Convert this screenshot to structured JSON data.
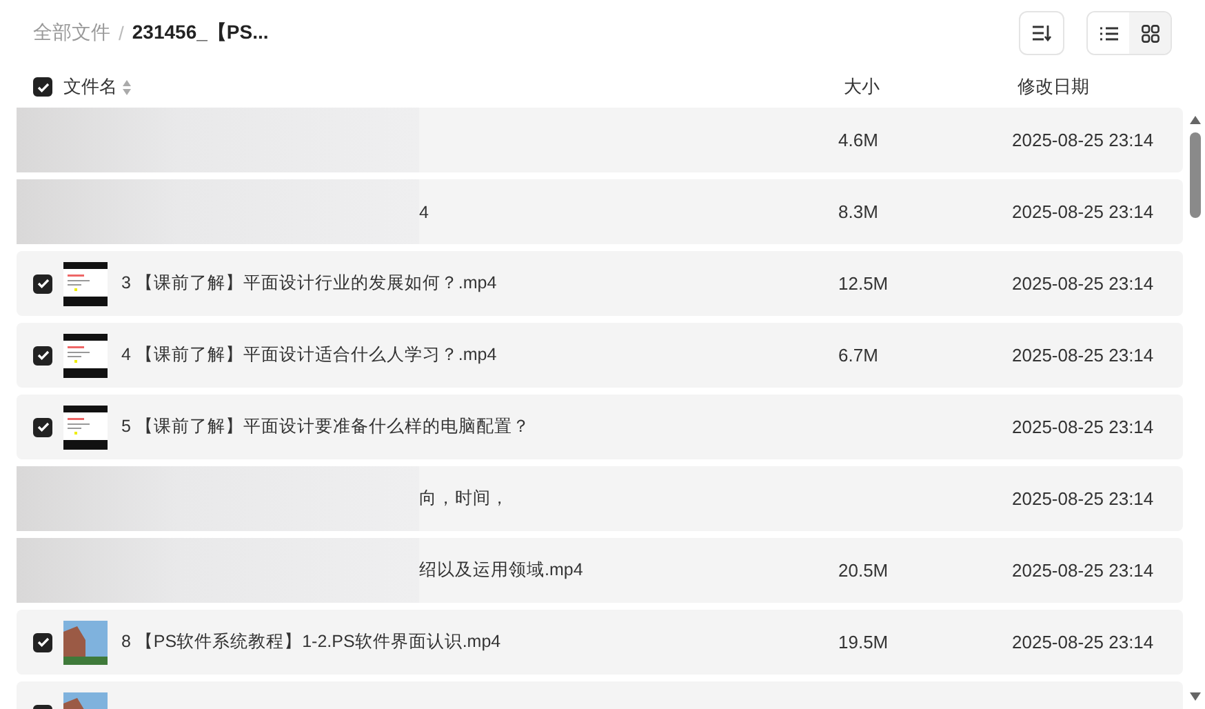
{
  "breadcrumb": [
    {
      "label": "全部文件",
      "current": false
    },
    {
      "label": "231456_【PS...",
      "current": true
    }
  ],
  "separator": "/",
  "view_toggle": [
    {
      "kind": "list",
      "selected": true
    },
    {
      "kind": "grid",
      "selected": false
    }
  ],
  "table": {
    "all_checked": true,
    "columns": [
      "文件名",
      "大小",
      "修改日期"
    ],
    "rows": [
      {
        "kind": "blurred",
        "size": "4.6M",
        "date": "2025-08-25 23:14"
      },
      {
        "kind": "blurred",
        "name": "4",
        "size": "8.3M",
        "date": "2025-08-25 23:14"
      },
      {
        "kind": "slide",
        "checked": true,
        "name": "3 【课前了解】平面设计行业的发展如何？.mp4",
        "size": "12.5M",
        "date": "2025-08-25 23:14"
      },
      {
        "kind": "slide",
        "checked": true,
        "name": "4 【课前了解】平面设计适合什么人学习？.mp4",
        "size": "6.7M",
        "date": "2025-08-25 23:14"
      },
      {
        "kind": "slide",
        "checked": true,
        "name": "5 【课前了解】平面设计要准备什么样的电脑配置？",
        "date": "2025-08-25 23:14"
      },
      {
        "kind": "blurred",
        "name": "向，时间，",
        "date": "2025-08-25 23:14"
      },
      {
        "kind": "blurred",
        "name": "绍以及运用领域.mp4",
        "size": "20.5M",
        "date": "2025-08-25 23:14"
      },
      {
        "kind": "photo",
        "checked": true,
        "name": "8 【PS软件系统教程】1-2.PS软件界面认识.mp4",
        "size": "19.5M",
        "date": "2025-08-25 23:14"
      },
      {
        "kind": "photo",
        "checked": true
      }
    ]
  }
}
